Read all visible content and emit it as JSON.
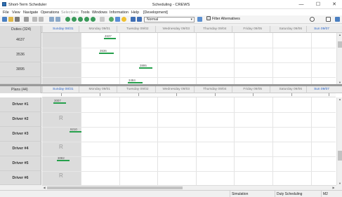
{
  "window": {
    "app_title": "Short-Term Scheduler",
    "center_title": "Scheduling - CREWS",
    "minimize": "—",
    "maximize": "☐",
    "close": "✕"
  },
  "menu": [
    "File",
    "View",
    "Navigate",
    "Operations",
    "Selections",
    "Tools",
    "Windows",
    "Information",
    "Help",
    "[Development]"
  ],
  "toolbar": {
    "view_mode": "Normal",
    "filter_label": "Filter Alternatives"
  },
  "days": [
    {
      "label": "Sunday 08/31",
      "today": true
    },
    {
      "label": "Monday 09/01",
      "today": false
    },
    {
      "label": "Tuesday 09/02",
      "today": false
    },
    {
      "label": "Wednesday 09/03",
      "today": false
    },
    {
      "label": "Thursday 09/04",
      "today": false
    },
    {
      "label": "Friday 09/05",
      "today": false
    },
    {
      "label": "Saturday 09/06",
      "today": false
    },
    {
      "label": "Sun 09/07",
      "today": true
    }
  ],
  "duties_pane": {
    "header": "Duties (324)",
    "rows": [
      {
        "label": "4637",
        "task": "4637"
      },
      {
        "label": "3536",
        "task": "3536"
      },
      {
        "label": "3895",
        "task": "3895"
      },
      {
        "label": "",
        "task": "3484"
      }
    ]
  },
  "plans_pane": {
    "header": "Plans (44)",
    "rows": [
      {
        "label": "Driver #1",
        "task": "3007",
        "rest": ""
      },
      {
        "label": "Driver #2",
        "task": "",
        "rest": "R"
      },
      {
        "label": "Driver #3",
        "task": "9210",
        "rest": ""
      },
      {
        "label": "Driver #4",
        "task": "",
        "rest": "R"
      },
      {
        "label": "Driver #5",
        "task": "3082",
        "rest": ""
      },
      {
        "label": "Driver #6",
        "task": "",
        "rest": "R"
      }
    ]
  },
  "status": {
    "mode": "Simulation",
    "module": "Duty Scheduling",
    "code": "M2"
  }
}
